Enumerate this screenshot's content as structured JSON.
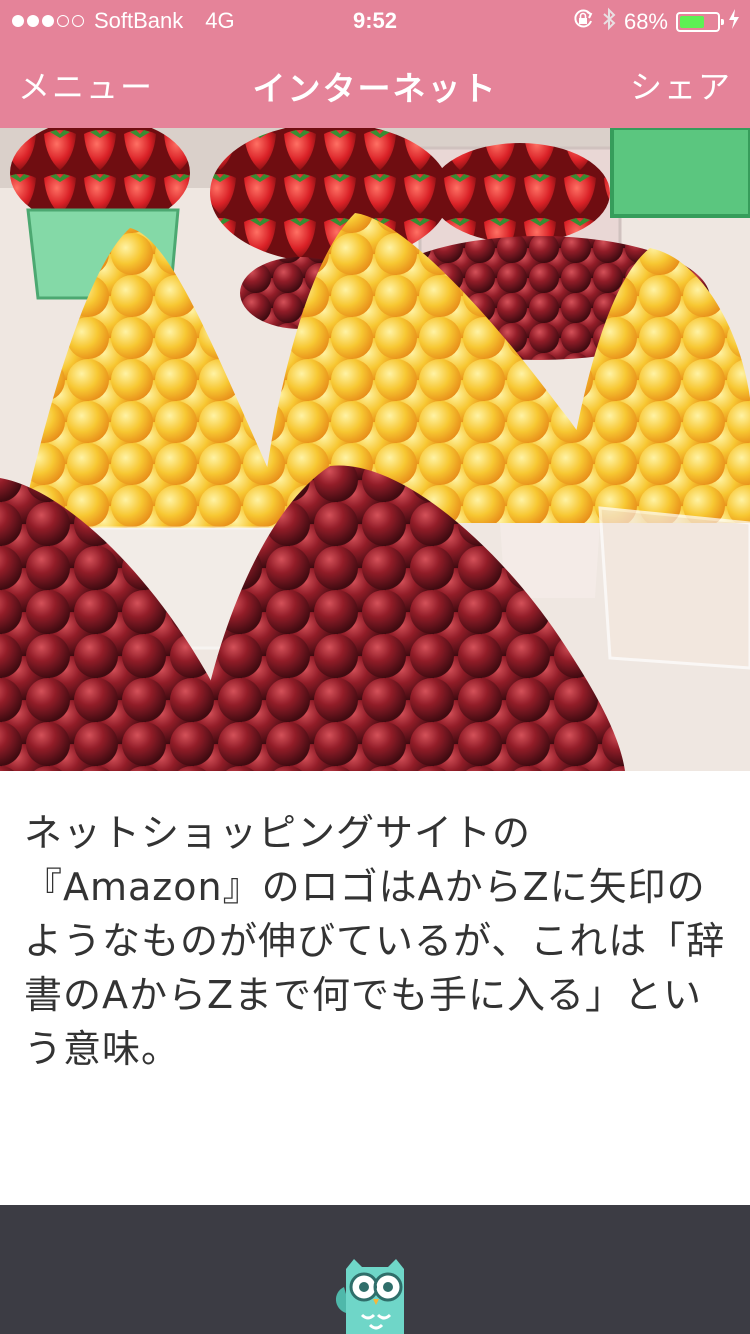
{
  "status_bar": {
    "signal_filled": 3,
    "signal_total": 5,
    "carrier": "SoftBank",
    "network": "4G",
    "time": "9:52",
    "battery_percent": "68%",
    "battery_level": 0.68,
    "icons": [
      "orientation-lock-icon",
      "bluetooth-icon",
      "battery-icon",
      "charging-bolt-icon"
    ]
  },
  "nav": {
    "menu_label": "メニュー",
    "title": "インターネット",
    "share_label": "シェア"
  },
  "hero": {
    "icon": "fruit-market-photo"
  },
  "article": {
    "text": "ネットショッピングサイトの『Amazon』のロゴはAからZに矢印のようなものが伸びているが、これは「辞書のAからZまで何でも手に入る」という意味。"
  },
  "footer": {
    "icon": "owl-mascot-icon"
  },
  "colors": {
    "accent": "#e58399",
    "footer_bg": "#3c3c44",
    "text": "#333333",
    "battery_fill": "#5ef154",
    "owl": "#6fd6c8"
  }
}
